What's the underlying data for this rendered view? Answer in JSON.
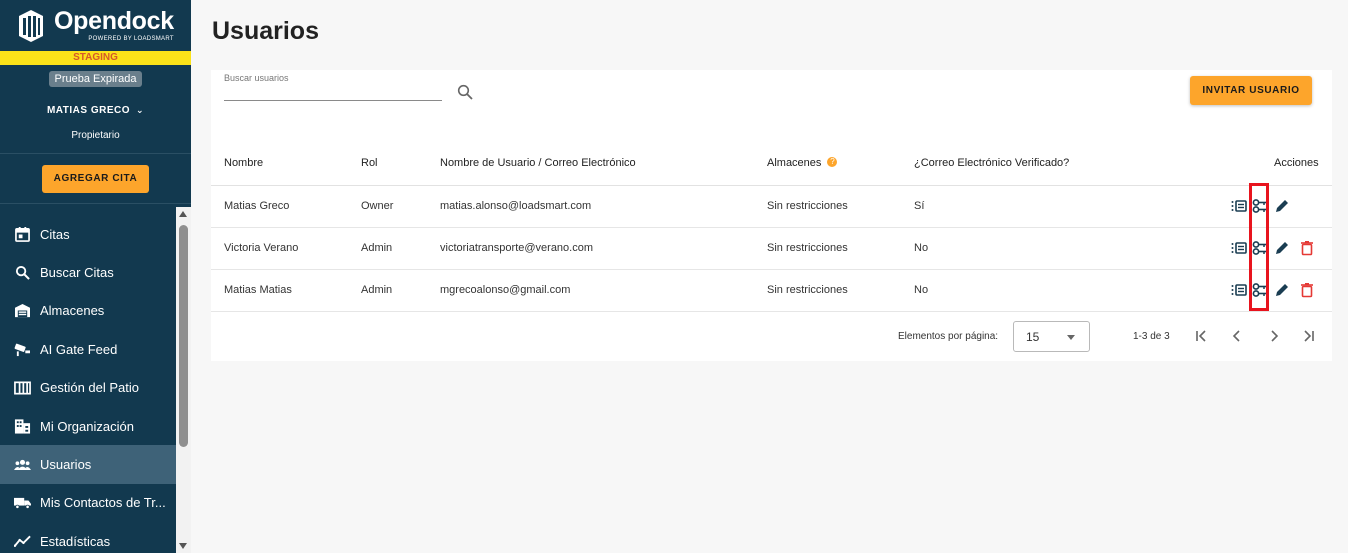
{
  "brand": {
    "name": "Opendock",
    "tagline": "POWERED BY LOADSMART",
    "env_banner": "STAGING",
    "trial_badge": "Prueba Expirada"
  },
  "user": {
    "name": "MATIAS GRECO",
    "role": "Propietario"
  },
  "sidebar": {
    "add_button": "AGREGAR CITA",
    "items": [
      {
        "label": "Citas",
        "icon": "calendar-icon"
      },
      {
        "label": "Buscar Citas",
        "icon": "search-icon"
      },
      {
        "label": "Almacenes",
        "icon": "warehouse-icon"
      },
      {
        "label": "AI Gate Feed",
        "icon": "camera-icon"
      },
      {
        "label": "Gestión del Patio",
        "icon": "yard-icon"
      },
      {
        "label": "Mi Organización",
        "icon": "building-icon"
      },
      {
        "label": "Usuarios",
        "icon": "users-icon"
      },
      {
        "label": "Mis Contactos de Tr...",
        "icon": "truck-icon"
      },
      {
        "label": "Estadísticas",
        "icon": "chart-icon"
      }
    ],
    "active_index": 6
  },
  "page": {
    "title": "Usuarios",
    "search_placeholder": "Buscar usuarios",
    "invite_button": "INVITAR USUARIO"
  },
  "table": {
    "headers": {
      "name": "Nombre",
      "role": "Rol",
      "email": "Nombre de Usuario / Correo Electrónico",
      "warehouses": "Almacenes",
      "verified": "¿Correo Electrónico Verificado?",
      "actions": "Acciones"
    },
    "rows": [
      {
        "name": "Matias Greco",
        "role": "Owner",
        "email": "matias.alonso@loadsmart.com",
        "warehouses": "Sin restricciones",
        "verified": "Sí"
      },
      {
        "name": "Victoria Verano",
        "role": "Admin",
        "email": "victoriatransporte@verano.com",
        "warehouses": "Sin restricciones",
        "verified": "No"
      },
      {
        "name": "Matias Matias",
        "role": "Admin",
        "email": "mgrecoalonso@gmail.com",
        "warehouses": "Sin restricciones",
        "verified": "No"
      }
    ]
  },
  "pagination": {
    "per_page_label": "Elementos por página:",
    "per_page_value": "15",
    "range": "1-3 de 3"
  },
  "colors": {
    "sidebar_bg": "#12394f",
    "accent": "#fda52b",
    "staging": "#fbe219",
    "delete": "#e53935",
    "highlight": "#e8141e"
  }
}
